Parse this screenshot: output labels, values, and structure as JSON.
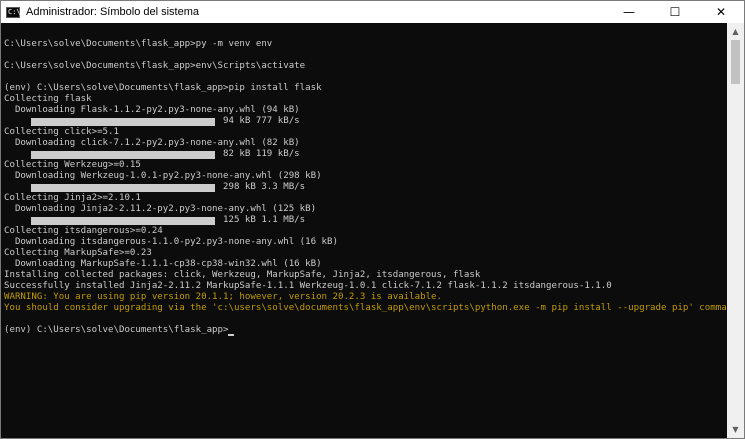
{
  "window": {
    "title": "Administrador: Símbolo del sistema",
    "controls": {
      "minimize": "—",
      "maximize": "☐",
      "close": "✕"
    }
  },
  "console": {
    "lines": [
      {
        "text": ""
      },
      {
        "text": "C:\\Users\\solve\\Documents\\flask_app>py -m venv env"
      },
      {
        "text": ""
      },
      {
        "text": "C:\\Users\\solve\\Documents\\flask_app>env\\Scripts\\activate"
      },
      {
        "text": ""
      },
      {
        "text": "(env) C:\\Users\\solve\\Documents\\flask_app>pip install flask"
      },
      {
        "text": "Collecting flask"
      },
      {
        "text": "  Downloading Flask-1.1.2-py2.py3-none-any.whl (94 kB)"
      },
      {
        "progress": "94 kB 777 kB/s",
        "fraction": 1.0
      },
      {
        "text": "Collecting click>=5.1"
      },
      {
        "text": "  Downloading click-7.1.2-py2.py3-none-any.whl (82 kB)"
      },
      {
        "progress": "82 kB 119 kB/s",
        "fraction": 1.0
      },
      {
        "text": "Collecting Werkzeug>=0.15"
      },
      {
        "text": "  Downloading Werkzeug-1.0.1-py2.py3-none-any.whl (298 kB)"
      },
      {
        "progress": "298 kB 3.3 MB/s",
        "fraction": 1.0
      },
      {
        "text": "Collecting Jinja2>=2.10.1"
      },
      {
        "text": "  Downloading Jinja2-2.11.2-py2.py3-none-any.whl (125 kB)"
      },
      {
        "progress": "125 kB 1.1 MB/s",
        "fraction": 1.0
      },
      {
        "text": "Collecting itsdangerous>=0.24"
      },
      {
        "text": "  Downloading itsdangerous-1.1.0-py2.py3-none-any.whl (16 kB)"
      },
      {
        "text": "Collecting MarkupSafe>=0.23"
      },
      {
        "text": "  Downloading MarkupSafe-1.1.1-cp38-cp38-win32.whl (16 kB)"
      },
      {
        "text": "Installing collected packages: click, Werkzeug, MarkupSafe, Jinja2, itsdangerous, flask"
      },
      {
        "text": "Successfully installed Jinja2-2.11.2 MarkupSafe-1.1.1 Werkzeug-1.0.1 click-7.1.2 flask-1.1.2 itsdangerous-1.1.0"
      },
      {
        "text": "WARNING: You are using pip version 20.1.1; however, version 20.2.3 is available.",
        "warn": true
      },
      {
        "text": "You should consider upgrading via the 'c:\\users\\solve\\documents\\flask_app\\env\\scripts\\python.exe -m pip install --upgrade pip' command.",
        "warn": true
      },
      {
        "text": ""
      },
      {
        "text": "(env) C:\\Users\\solve\\Documents\\flask_app>",
        "cursor": true
      }
    ]
  },
  "colors": {
    "console_bg": "#0c0c0c",
    "console_fg": "#cccccc",
    "warning_fg": "#c19c00",
    "titlebar_bg": "#ffffff"
  },
  "icons": {
    "app": "console-app-icon",
    "scroll_up": "scroll-up-arrow-icon",
    "scroll_down": "scroll-down-arrow-icon"
  }
}
